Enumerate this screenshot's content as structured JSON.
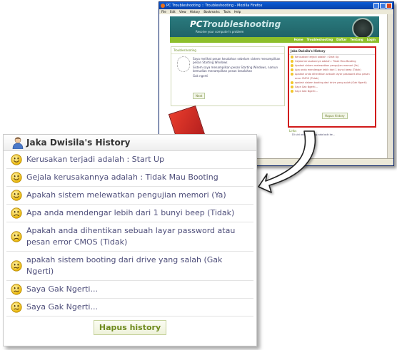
{
  "browser": {
    "title": "PC Troubleshooting :: Troubleshooting - Mozilla Firefox",
    "menu": [
      "File",
      "Edit",
      "View",
      "History",
      "Bookmarks",
      "Tools",
      "Help"
    ],
    "site": {
      "logo_pc": "PC",
      "logo_rest": "Troubleshooting",
      "tagline": "Resolve your computer's problem",
      "nav": [
        "Home",
        "Troubleshooting",
        "Daftar",
        "Tentang",
        "Login"
      ],
      "left_heading": "Troubleshooting",
      "options": [
        "Saya melihat pesan kesalahan sebelum sistem menampilkan pesan Starting Windows",
        "Sistem saya menampilkan pesan Starting Windows, namun kemudian menampilkan pesan kesalahan",
        "Gak ngerti"
      ],
      "next_label": "Next",
      "history_heading": "Jaka Dwisila's History",
      "history_lines": [
        "Kerusakan terjadi adalah : Start Up",
        "Gejala kerusakannya adalah : Tidak Mau Booting",
        "Apakah sistem melewatkan pengujian memori (Ya)",
        "Apa anda mendengar lebih dari 1 bunyi beep (Tidak)",
        "Apakah anda dihentikan sebuah layar password atau pesan error CMOS (Tidak)",
        "apakah sistem booting dari drive yang salah (Gak Ngerti)",
        "Saya Gak Ngerti...",
        "Saya Gak Ngerti..."
      ],
      "history_button": "Hapus history",
      "links_heading": "Links",
      "link_text": "Di sini ada link yang ada baik ke..."
    }
  },
  "panel": {
    "title": "Jaka Dwisila's History",
    "items": [
      {
        "text": "Kerusakan terjadi adalah : Start Up",
        "face": "smile"
      },
      {
        "text": "Gejala kerusakannya adalah : Tidak Mau Booting",
        "face": "smile"
      },
      {
        "text": "Apakah sistem melewatkan pengujian memori (Ya)",
        "face": "smile"
      },
      {
        "text": "Apa anda mendengar lebih dari 1 bunyi beep (Tidak)",
        "face": "frown"
      },
      {
        "text": "Apakah anda dihentikan sebuah layar password atau pesan error CMOS (Tidak)",
        "face": "frown"
      },
      {
        "text": "apakah sistem booting dari drive yang salah (Gak Ngerti)",
        "face": "confused"
      },
      {
        "text": "Saya Gak Ngerti...",
        "face": "confused"
      },
      {
        "text": "Saya Gak Ngerti...",
        "face": "confused"
      }
    ],
    "button_label": "Hapus history",
    "colors": {
      "text": "#4e4e7a",
      "button_text": "#6e8a1e",
      "highlight": "#d11a1a"
    }
  }
}
